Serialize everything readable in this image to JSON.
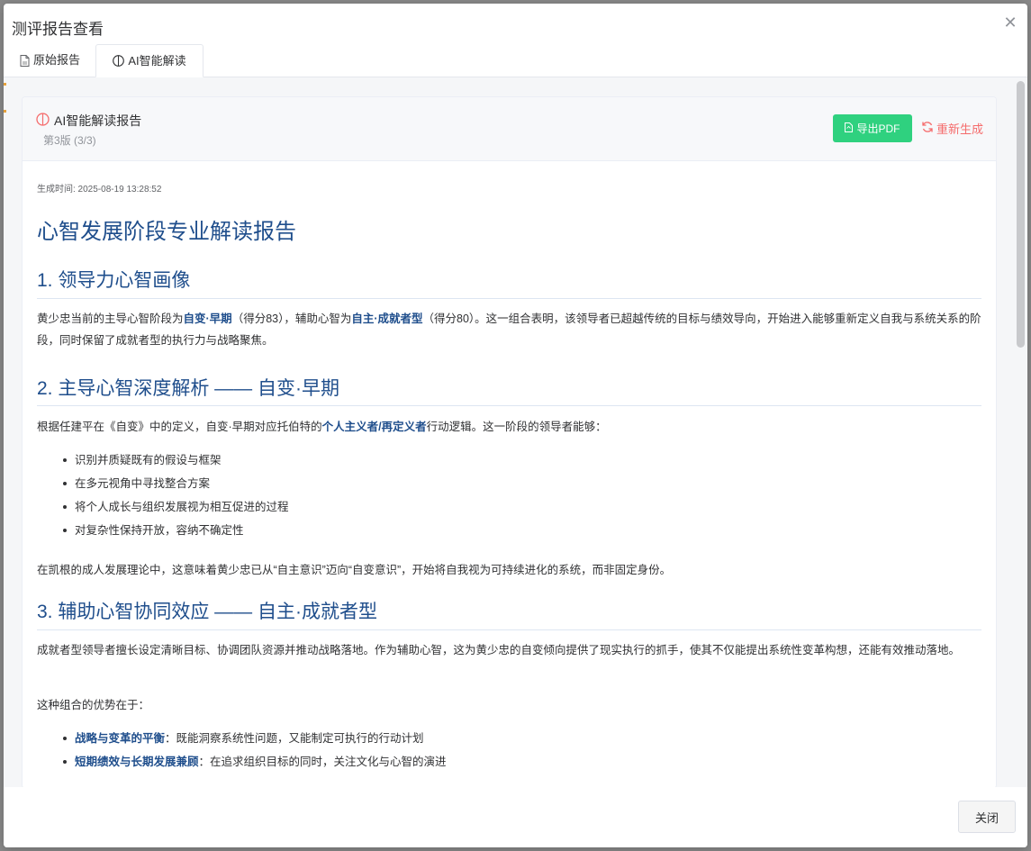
{
  "dialog": {
    "title": "测评报告查看",
    "close_icon": "close-icon",
    "close_button_label": "关闭"
  },
  "tabs": [
    {
      "label": "原始报告",
      "icon": "document-icon",
      "active": false
    },
    {
      "label": "AI智能解读",
      "icon": "brain-icon",
      "active": true
    }
  ],
  "card": {
    "title": "AI智能解读报告",
    "version": "第3版 (3/3)",
    "export_pdf_label": "导出PDF",
    "regenerate_label": "重新生成",
    "colors": {
      "export_button": "#2fd17f",
      "regenerate": "#f56c6c",
      "heading": "#1f4e8c"
    }
  },
  "report": {
    "generated_time": "生成时间: 2025-08-19 13:28:52",
    "title": "心智发展阶段专业解读报告",
    "s1": {
      "heading": "1. 领导力心智画像",
      "p1_a": "黄少忠当前的主导心智阶段为",
      "p1_b1": "自变·早期",
      "p1_c": "（得分83），辅助心智为",
      "p1_b2": "自主·成就者型",
      "p1_d": "（得分80）。这一组合表明，该领导者已超越传统的目标与绩效导向，开始进入能够重新定义自我与系统关系的阶段，同时保留了成就者型的执行力与战略聚焦。"
    },
    "s2": {
      "heading": "2. 主导心智深度解析 —— 自变·早期",
      "p1_a": "根据任建平在《自变》中的定义，自变·早期对应托伯特的",
      "p1_b": "个人主义者/再定义者",
      "p1_c": "行动逻辑。这一阶段的领导者能够：",
      "bullets": [
        "识别并质疑既有的假设与框架",
        "在多元视角中寻找整合方案",
        "将个人成长与组织发展视为相互促进的过程",
        "对复杂性保持开放，容纳不确定性"
      ],
      "p2": "在凯根的成人发展理论中，这意味着黄少忠已从“自主意识”迈向“自变意识”，开始将自我视为可持续进化的系统，而非固定身份。"
    },
    "s3": {
      "heading": "3. 辅助心智协同效应 —— 自主·成就者型",
      "p1": "成就者型领导者擅长设定清晰目标、协调团队资源并推动战略落地。作为辅助心智，这为黄少忠的自变倾向提供了现实执行的抓手，使其不仅能提出系统性变革构想，还能有效推动落地。",
      "p2": "这种组合的优势在于：",
      "bullets": [
        {
          "bold": "战略与变革的平衡",
          "text": "：既能洞察系统性问题，又能制定可执行的行动计划"
        },
        {
          "bold": "短期绩效与长期发展兼顾",
          "text": "：在追求组织目标的同时，关注文化与心智的演进"
        }
      ]
    }
  }
}
